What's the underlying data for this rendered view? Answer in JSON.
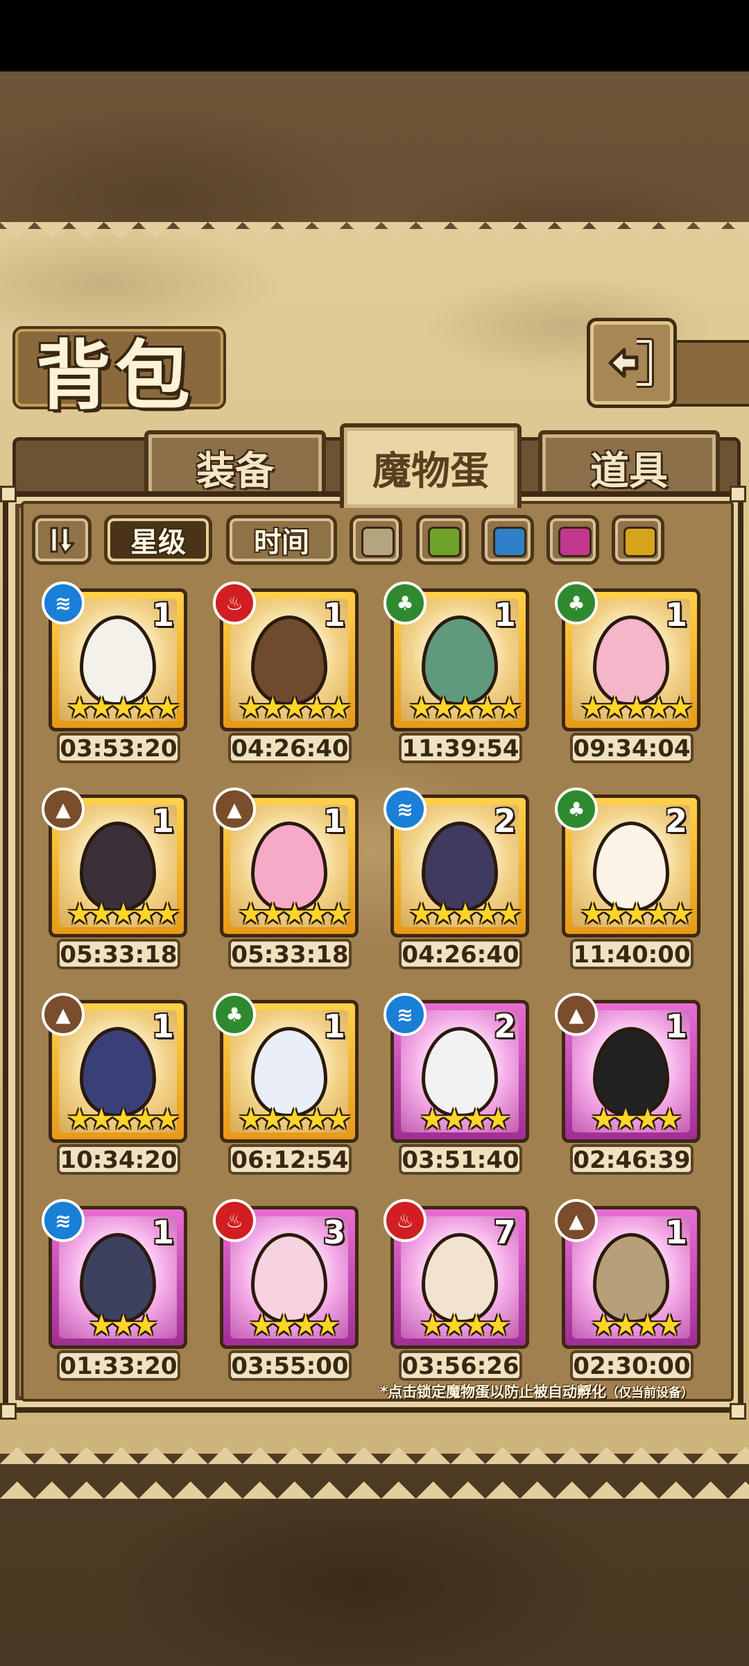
{
  "page": {
    "title": "背包"
  },
  "tabs": [
    {
      "label": "装备",
      "active": false
    },
    {
      "label": "魔物蛋",
      "active": true
    },
    {
      "label": "道具",
      "active": false
    }
  ],
  "filters": {
    "sort_icon": "sort-toggle-icon",
    "star_label": "星级",
    "time_label": "时间",
    "active": "星级",
    "swatches": [
      "#b4a57f",
      "#6fa22a",
      "#2f80c8",
      "#c2388f",
      "#d4a51a"
    ]
  },
  "element_colors": {
    "water": "#1a7fd6",
    "fire": "#d11e22",
    "nature": "#2f8a2f",
    "earth": "#7a4d2c"
  },
  "eggs": [
    {
      "element": "water",
      "count": "1",
      "stars": "★★★★★",
      "time": "03:53:20",
      "rarity": "gold",
      "color": "#f4f1ea"
    },
    {
      "element": "fire",
      "count": "1",
      "stars": "★★★★★",
      "time": "04:26:40",
      "rarity": "gold",
      "color": "#6e4a2e"
    },
    {
      "element": "nature",
      "count": "1",
      "stars": "★★★★★",
      "time": "11:39:54",
      "rarity": "gold",
      "color": "#5f9a7c"
    },
    {
      "element": "nature",
      "count": "1",
      "stars": "★★★★★",
      "time": "09:34:04",
      "rarity": "gold",
      "color": "#f4b6c8"
    },
    {
      "element": "earth",
      "count": "1",
      "stars": "★★★★★",
      "time": "05:33:18",
      "rarity": "gold",
      "color": "#3b2f3a"
    },
    {
      "element": "earth",
      "count": "1",
      "stars": "★★★★★",
      "time": "05:33:18",
      "rarity": "gold",
      "color": "#f7a9c8"
    },
    {
      "element": "water",
      "count": "2",
      "stars": "★★★★★",
      "time": "04:26:40",
      "rarity": "gold",
      "color": "#3f3a5e"
    },
    {
      "element": "nature",
      "count": "2",
      "stars": "★★★★★",
      "time": "11:40:00",
      "rarity": "gold",
      "color": "#fbf4e6"
    },
    {
      "element": "earth",
      "count": "1",
      "stars": "★★★★★",
      "time": "10:34:20",
      "rarity": "gold",
      "color": "#3a3f78"
    },
    {
      "element": "nature",
      "count": "1",
      "stars": "★★★★★",
      "time": "06:12:54",
      "rarity": "gold",
      "color": "#e9eef8"
    },
    {
      "element": "water",
      "count": "2",
      "stars": "★★★★",
      "time": "03:51:40",
      "rarity": "pink",
      "color": "#f2f2f2"
    },
    {
      "element": "earth",
      "count": "1",
      "stars": "★★★★",
      "time": "02:46:39",
      "rarity": "pink",
      "color": "#222222"
    },
    {
      "element": "water",
      "count": "1",
      "stars": "★★★",
      "time": "01:33:20",
      "rarity": "pink",
      "color": "#3d4160"
    },
    {
      "element": "fire",
      "count": "3",
      "stars": "★★★★",
      "time": "03:55:00",
      "rarity": "pink",
      "color": "#f7d3e2"
    },
    {
      "element": "fire",
      "count": "7",
      "stars": "★★★★",
      "time": "03:56:26",
      "rarity": "pink",
      "color": "#f1e3cf"
    },
    {
      "element": "earth",
      "count": "1",
      "stars": "★★★★",
      "time": "02:30:00",
      "rarity": "pink",
      "color": "#b79f7a"
    }
  ],
  "footnote": {
    "main": "*点击锁定魔物蛋以防止被自动孵化",
    "note": "（仅当前设备）"
  }
}
